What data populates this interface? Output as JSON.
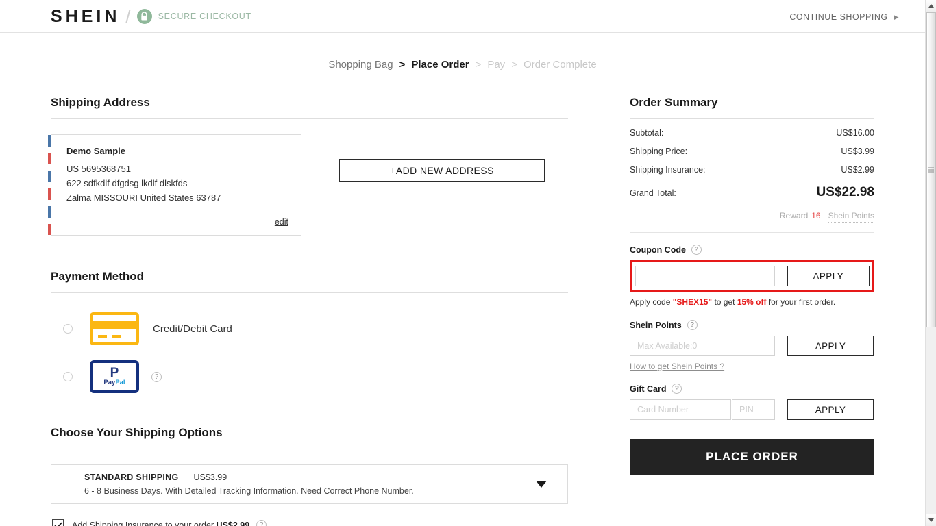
{
  "header": {
    "logo": "SHEIN",
    "divider": "/",
    "lock_icon": "lock-icon",
    "secure_label": "SECURE CHECKOUT",
    "continue_shopping": "CONTINUE SHOPPING",
    "continue_caret": "▶"
  },
  "steps": {
    "sep": ">",
    "items": [
      {
        "label": "Shopping Bag",
        "state": "done"
      },
      {
        "label": "Place Order",
        "state": "active"
      },
      {
        "label": "Pay",
        "state": "future"
      },
      {
        "label": "Order Complete",
        "state": "future"
      }
    ]
  },
  "shipping_address": {
    "title": "Shipping Address",
    "name": "Demo Sample",
    "phone": "US 5695368751",
    "street": "622 sdfkdlf dfgdsg lkdlf dlskfds",
    "city_line": "Zalma MISSOURI United States 63787",
    "edit_label": "edit",
    "add_new_label": "+ADD NEW ADDRESS"
  },
  "payment_method": {
    "title": "Payment Method",
    "options": [
      {
        "label": "Credit/Debit Card",
        "icon": "credit-card-icon",
        "selected": false
      },
      {
        "label": "",
        "icon": "paypal-icon",
        "selected": false,
        "paypal_glyph": "P",
        "paypal_word_a": "Pay",
        "paypal_word_b": "Pal"
      }
    ],
    "help_icon": "?"
  },
  "shipping_options": {
    "title": "Choose Your Shipping Options",
    "selected": {
      "name": "STANDARD SHIPPING",
      "price": "US$3.99",
      "description": "6 - 8 Business Days. With Detailed Tracking Information. Need Correct Phone Number."
    },
    "insurance": {
      "checked": true,
      "text_before": "Add Shipping Insurance to your order ",
      "price": "US$2.99",
      "help_icon": "?"
    }
  },
  "order_summary": {
    "title": "Order Summary",
    "rows": [
      {
        "label": "Subtotal:",
        "value": "US$16.00"
      },
      {
        "label": "Shipping Price:",
        "value": "US$3.99"
      },
      {
        "label": "Shipping Insurance:",
        "value": "US$2.99"
      }
    ],
    "grand_total_label": "Grand Total:",
    "grand_total_value": "US$22.98",
    "reward_label": "Reward",
    "reward_points": "16",
    "reward_suffix": "Shein Points"
  },
  "coupon": {
    "label": "Coupon Code",
    "help_icon": "?",
    "input_value": "",
    "input_placeholder": "",
    "apply_label": "APPLY",
    "hint_part1": "Apply code ",
    "hint_code": "\"SHEX15\"",
    "hint_part2": " to get ",
    "hint_discount": "15% off",
    "hint_part3": " for your first order.",
    "highlight_color": "#e61919"
  },
  "shein_points": {
    "label": "Shein Points",
    "help_icon": "?",
    "input_placeholder": "Max Available:0",
    "apply_label": "APPLY",
    "how_link": "How to get Shein Points ?"
  },
  "gift_card": {
    "label": "Gift Card",
    "help_icon": "?",
    "card_placeholder": "Card Number",
    "pin_placeholder": "PIN",
    "apply_label": "APPLY"
  },
  "place_order": {
    "label": "PLACE ORDER"
  },
  "colors": {
    "accent_red": "#e61919",
    "secure_green": "#8fb89a",
    "card_yellow": "#fbb713",
    "paypal_blue": "#14307e",
    "dark_button": "#232323"
  }
}
